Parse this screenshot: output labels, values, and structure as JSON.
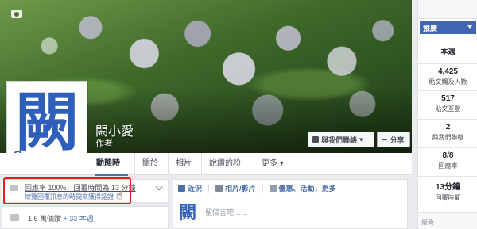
{
  "profile": {
    "name": "闕小愛",
    "category": "作者",
    "avatar_char": "闕"
  },
  "cover": {
    "contact_button": "與我們聯絡",
    "share_button": "分享"
  },
  "tabs": [
    {
      "label": "動態時報"
    },
    {
      "label": "關於"
    },
    {
      "label": "相片"
    },
    {
      "label": "說讚的粉絲"
    },
    {
      "label": "更多"
    }
  ],
  "response": {
    "line1": "回應率 100%，回覆時間為 13 分鐘",
    "line2": "總覽回覆訊息的時間來獲得認證"
  },
  "likes": {
    "count": "1.6 萬個讚",
    "week": "+ 33 本週"
  },
  "composer": {
    "tab_status": "近況",
    "tab_photo": "相片/影片",
    "tab_event": "優惠、活動，更多",
    "placeholder": "留個言吧……"
  },
  "sidebar": {
    "promote_label": "推廣",
    "week_label": "本週",
    "stats": [
      {
        "value": "4,425",
        "label": "貼文觸及人數"
      },
      {
        "value": "517",
        "label": "貼文互動"
      },
      {
        "value": "2",
        "label": "與我們聯絡"
      },
      {
        "value": "8/8",
        "label": "回應率"
      },
      {
        "value": "13分鐘",
        "label": "回覆時間"
      }
    ],
    "recent_label": "最新"
  },
  "colors": {
    "accent_blue": "#4267b2",
    "highlight_red": "#e02020",
    "link_blue": "#4b6ea8"
  }
}
